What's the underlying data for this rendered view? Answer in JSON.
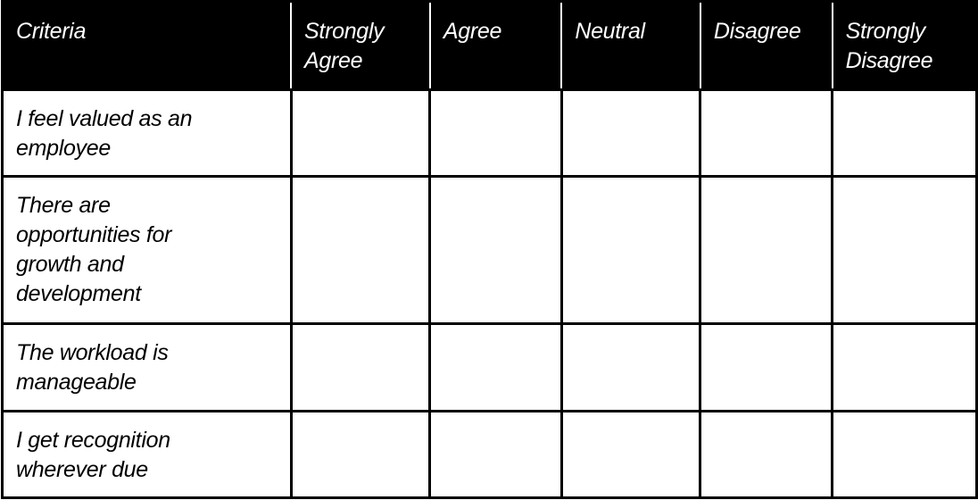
{
  "table": {
    "headers": [
      "Criteria",
      "Strongly Agree",
      "Agree",
      "Neutral",
      "Disagree",
      "Strongly Disagree"
    ],
    "rows": [
      {
        "criterion": "I feel valued as an employee",
        "responses": [
          "",
          "",
          "",
          "",
          ""
        ]
      },
      {
        "criterion": "There are opportunities for growth and development",
        "responses": [
          "",
          "",
          "",
          "",
          ""
        ]
      },
      {
        "criterion": "The workload is manageable",
        "responses": [
          "",
          "",
          "",
          "",
          ""
        ]
      },
      {
        "criterion": "I get recognition wherever due",
        "responses": [
          "",
          "",
          "",
          "",
          ""
        ]
      }
    ]
  },
  "colors": {
    "header_background": "#000000",
    "header_text": "#ffffff",
    "body_background": "#ffffff",
    "body_text": "#000000",
    "grid_lines": "#000000"
  }
}
